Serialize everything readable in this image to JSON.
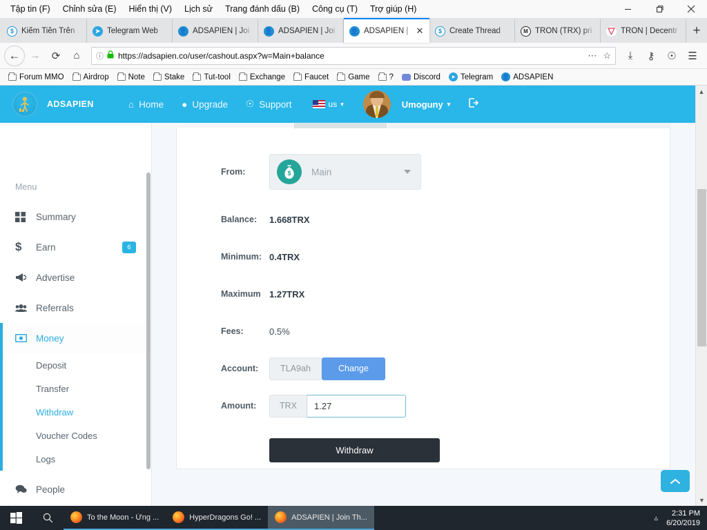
{
  "browser": {
    "menubar": [
      {
        "label": "Tập tin (F)"
      },
      {
        "label": "Chỉnh sửa (E)"
      },
      {
        "label": "Hiển thị (V)"
      },
      {
        "label": "Lịch sử"
      },
      {
        "label": "Trang đánh dấu (B)"
      },
      {
        "label": "Công cụ (T)"
      },
      {
        "label": "Trợ giúp (H)"
      }
    ],
    "window_controls": {
      "minimize": "minimize-icon",
      "restore": "restore-icon",
      "close": "close-icon"
    },
    "tabs": [
      {
        "title": "Kiếm Tiền Trên",
        "favicon": "s-circle-icon",
        "active": false
      },
      {
        "title": "Telegram Web",
        "favicon": "telegram-icon",
        "active": false
      },
      {
        "title": "ADSAPIEN | Joi",
        "favicon": "adsapien-icon",
        "active": false
      },
      {
        "title": "ADSAPIEN | Joi",
        "favicon": "adsapien-icon",
        "active": false
      },
      {
        "title": "ADSAPIEN |",
        "favicon": "adsapien-icon",
        "active": true
      },
      {
        "title": "Create Thread",
        "favicon": "s-circle-icon",
        "active": false
      },
      {
        "title": "TRON (TRX) pri",
        "favicon": "coinmarketcap-icon",
        "active": false
      },
      {
        "title": "TRON | Decentr",
        "favicon": "tron-icon",
        "active": false
      }
    ],
    "new_tab_label": "+",
    "close_tab_label": "✕",
    "nav": {
      "back": "back-arrow-icon",
      "forward": "forward-arrow-icon",
      "reload": "reload-icon",
      "home": "home-icon",
      "url_scheme": "https://",
      "url_host": "adsapien.co",
      "url_path": "/user/cashout.aspx?w=Main+balance",
      "url_full": "https://adsapien.co/user/cashout.aspx?w=Main+balance",
      "page_actions": "⋯",
      "bookmark_star": "☆",
      "downloads": "download-icon",
      "account": "account-icon",
      "sync": "sync-icon",
      "menu": "hamburger-menu-icon"
    },
    "bookmarks": [
      {
        "label": "Forum MMO",
        "icon": "folder-icon"
      },
      {
        "label": "Airdrop",
        "icon": "folder-icon"
      },
      {
        "label": "Note",
        "icon": "folder-icon"
      },
      {
        "label": "Stake",
        "icon": "folder-icon"
      },
      {
        "label": "Tut-tool",
        "icon": "folder-icon"
      },
      {
        "label": "Exchange",
        "icon": "folder-icon"
      },
      {
        "label": "Faucet",
        "icon": "folder-icon"
      },
      {
        "label": "Game",
        "icon": "folder-icon"
      },
      {
        "label": "?",
        "icon": "folder-icon"
      },
      {
        "label": "Discord",
        "icon": "discord-icon"
      },
      {
        "label": "Telegram",
        "icon": "telegram-icon"
      },
      {
        "label": "ADSAPIEN",
        "icon": "adsapien-icon"
      }
    ]
  },
  "site": {
    "brand": "ADSAPIEN",
    "nav": [
      {
        "label": "Home",
        "icon": "home-icon"
      },
      {
        "label": "Upgrade",
        "icon": "upgrade-icon"
      },
      {
        "label": "Support",
        "icon": "lifebuoy-icon"
      }
    ],
    "language": "us",
    "username": "Umoguny",
    "logout": "logout-icon"
  },
  "sidebar": {
    "caption": "Menu",
    "items": [
      {
        "label": "Summary",
        "icon": "grid-icon",
        "badge": null,
        "active": false
      },
      {
        "label": "Earn",
        "icon": "dollar-icon",
        "badge": "6",
        "active": false
      },
      {
        "label": "Advertise",
        "icon": "megaphone-icon",
        "badge": null,
        "active": false
      },
      {
        "label": "Referrals",
        "icon": "users-icon",
        "badge": null,
        "active": false
      },
      {
        "label": "Money",
        "icon": "banknote-icon",
        "badge": null,
        "active": true
      }
    ],
    "submenu": [
      {
        "label": "Deposit",
        "current": false
      },
      {
        "label": "Transfer",
        "current": false
      },
      {
        "label": "Withdraw",
        "current": true
      },
      {
        "label": "Voucher Codes",
        "current": false
      },
      {
        "label": "Logs",
        "current": false
      }
    ],
    "footer_items": [
      {
        "label": "People",
        "icon": "chat-icon"
      }
    ]
  },
  "form": {
    "from_label": "From:",
    "from_value": "Main",
    "from_icon": "money-bag-icon",
    "balance_label": "Balance:",
    "balance_value": "1.668TRX",
    "minimum_label": "Minimum:",
    "minimum_value": "0.4TRX",
    "maximum_label": "Maximum",
    "maximum_value": "1.27TRX",
    "fees_label": "Fees:",
    "fees_value": "0.5%",
    "account_label": "Account:",
    "account_value": "TLA9ah",
    "change_button": "Change",
    "amount_label": "Amount:",
    "amount_currency": "TRX",
    "amount_value": "1.27",
    "withdraw_button": "Withdraw",
    "scroll_top_icon": "chevron-up-icon"
  },
  "taskbar": {
    "start": "windows-logo-icon",
    "search": "search-icon",
    "apps": [
      {
        "label": "To the Moon - Ứng ...",
        "icon": "firefox-icon",
        "active": false
      },
      {
        "label": "HyperDragons Go! ...",
        "icon": "firefox-icon",
        "active": false
      },
      {
        "label": "ADSAPIEN | Join Th...",
        "icon": "firefox-icon",
        "active": true
      }
    ],
    "tray_chevron": "chevron-up-icon",
    "time": "2:31 PM",
    "date": "6/20/2019"
  },
  "colors": {
    "brand_blue": "#29b6e8",
    "accent_blue": "#2bade0",
    "change_button": "#5b9bea",
    "withdraw_button": "#2b3138",
    "coin_teal": "#26a69a"
  }
}
